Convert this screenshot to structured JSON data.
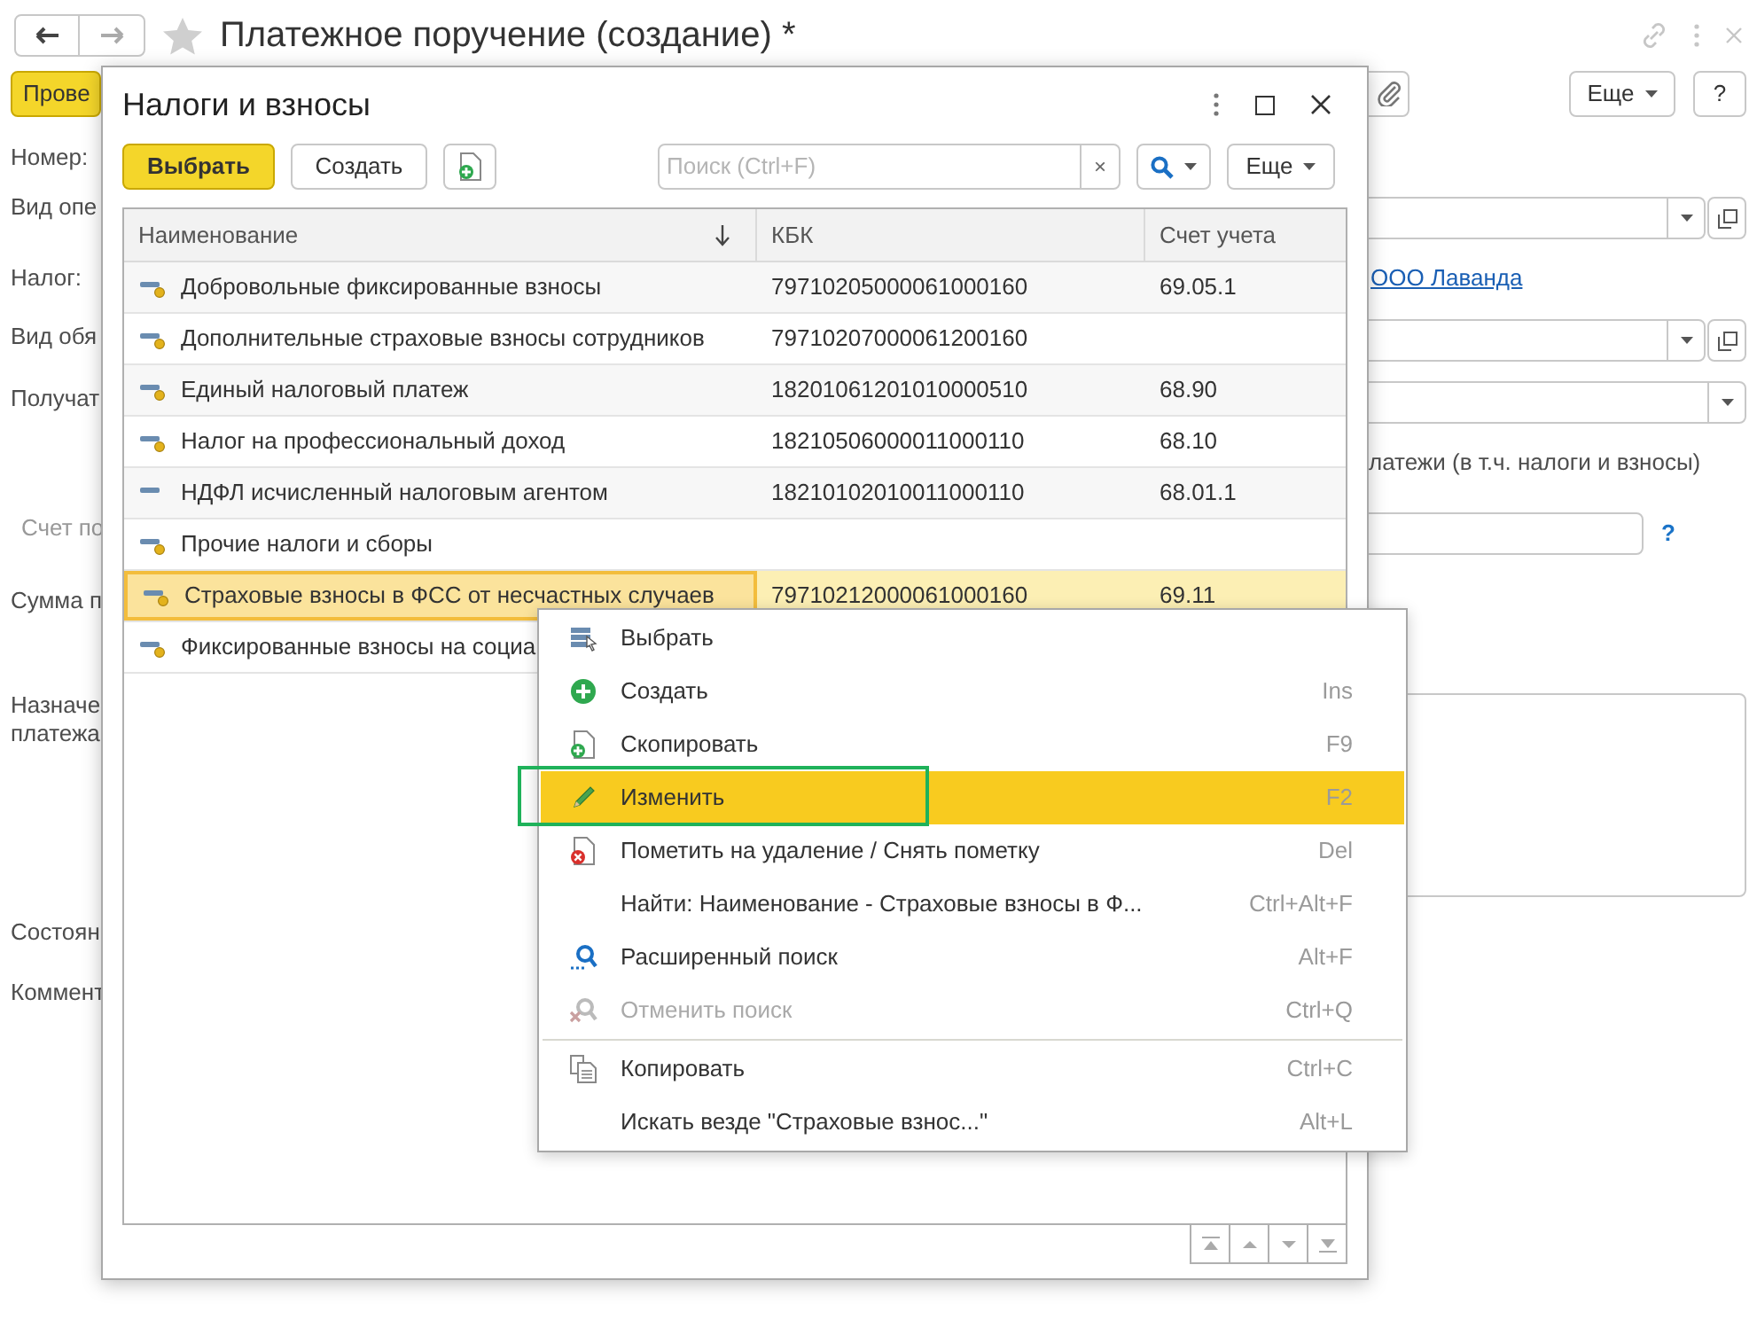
{
  "form": {
    "title": "Платежное поручение (создание) *",
    "post_button": "Прове",
    "more_button": "Еще",
    "help_button": "?",
    "labels": [
      {
        "text": "Номер:",
        "kind": "normal"
      },
      {
        "text": "Вид опе",
        "kind": "normal"
      },
      {
        "text": "Налог:",
        "kind": "normal"
      },
      {
        "text": "Вид обя",
        "kind": "normal"
      },
      {
        "text": "Получат",
        "kind": "normal"
      },
      {
        "text": "Счет по",
        "kind": "secondary"
      },
      {
        "text": "Сумма п",
        "kind": "normal"
      },
      {
        "text": "Назначе\nплатежа",
        "kind": "normal"
      },
      {
        "text": "Состоян",
        "kind": "normal"
      },
      {
        "text": "Коммент",
        "kind": "normal"
      }
    ],
    "right_items": [
      {
        "kind": "select-open"
      },
      {
        "kind": "link",
        "text": "ООО Лаванда"
      },
      {
        "kind": "select-open"
      },
      {
        "kind": "select"
      },
      {
        "kind": "text",
        "text": "латежи (в т.ч. налоги и взносы)"
      },
      {
        "kind": "input-help",
        "help": "?"
      },
      {
        "kind": "textarea"
      }
    ]
  },
  "dialog": {
    "title": "Налоги и взносы",
    "choose_button": "Выбрать",
    "create_button": "Создать",
    "search": {
      "placeholder": "Поиск (Ctrl+F)",
      "clear": "×"
    },
    "more_button": "Еще",
    "columns": [
      {
        "label": "Наименование",
        "sorted": true
      },
      {
        "label": "КБК",
        "sorted": false
      },
      {
        "label": "Счет учета",
        "sorted": false
      }
    ],
    "rows": [
      {
        "name": "Добровольные фиксированные взносы",
        "kbk": "79710205000061000160",
        "account": "69.05.1",
        "predefined": true,
        "selected": false
      },
      {
        "name": "Дополнительные страховые взносы сотрудников",
        "kbk": "79710207000061200160",
        "predefined": true,
        "selected": false
      },
      {
        "name": "Единый налоговый платеж",
        "kbk": "18201061201010000510",
        "account": "68.90",
        "predefined": true,
        "selected": false
      },
      {
        "name": "Налог на профессиональный доход",
        "kbk": "18210506000011000110",
        "account": "68.10",
        "predefined": true,
        "selected": false
      },
      {
        "name": "НДФЛ исчисленный налоговым агентом",
        "kbk": "18210102010011000110",
        "account": "68.01.1",
        "predefined": false,
        "selected": false
      },
      {
        "name": "Прочие налоги и сборы",
        "predefined": true,
        "selected": false
      },
      {
        "name": "Страховые взносы в ФСС от несчастных случаев",
        "kbk": "79710212000061000160",
        "account": "69.11",
        "predefined": true,
        "selected": true
      },
      {
        "name": "Фиксированные взносы на социа",
        "predefined": true,
        "selected": false
      }
    ]
  },
  "context_menu": {
    "sections": [
      [
        {
          "label": "Выбрать",
          "kind": "select",
          "selected": false,
          "disabled": false,
          "framed": false
        },
        {
          "label": "Создать",
          "shortcut": "Ins",
          "kind": "create",
          "selected": false,
          "disabled": false,
          "framed": false
        },
        {
          "label": "Скопировать",
          "shortcut": "F9",
          "kind": "copy",
          "selected": false,
          "disabled": false,
          "framed": false
        },
        {
          "label": "Изменить",
          "shortcut": "F2",
          "kind": "edit",
          "selected": true,
          "disabled": false,
          "framed": true
        },
        {
          "label": "Пометить на удаление / Снять пометку",
          "shortcut": "Del",
          "kind": "delete",
          "selected": false,
          "disabled": false,
          "framed": false
        },
        {
          "label": "Найти: Наименование - Страховые взносы в Ф...",
          "shortcut": "Ctrl+Alt+F",
          "kind": "plain",
          "selected": false,
          "disabled": false,
          "framed": false
        },
        {
          "label": "Расширенный поиск",
          "shortcut": "Alt+F",
          "kind": "search",
          "selected": false,
          "disabled": false,
          "framed": false
        },
        {
          "label": "Отменить поиск",
          "shortcut": "Ctrl+Q",
          "kind": "cancel-search",
          "selected": false,
          "disabled": true,
          "framed": false
        }
      ],
      [
        {
          "label": "Копировать",
          "shortcut": "Ctrl+C",
          "kind": "clipboard",
          "selected": false,
          "disabled": false,
          "framed": false
        },
        {
          "label": "Искать везде \"Страховые взнос...\"",
          "shortcut": "Alt+L",
          "kind": "plain",
          "selected": false,
          "disabled": false,
          "framed": false
        }
      ]
    ]
  }
}
